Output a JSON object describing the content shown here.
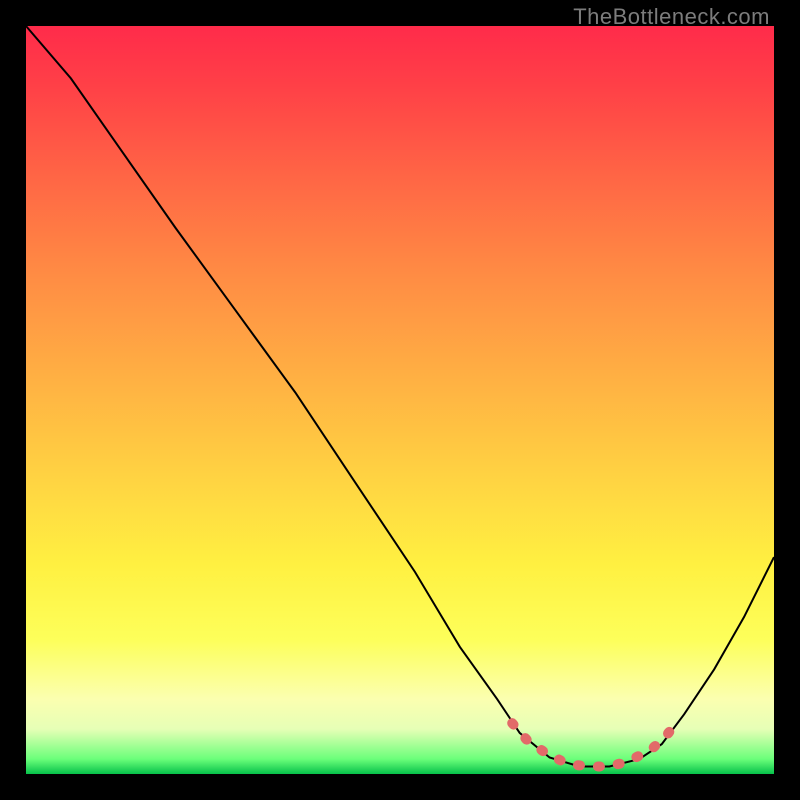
{
  "watermark": "TheBottleneck.com",
  "chart_data": {
    "type": "line",
    "title": "",
    "xlabel": "",
    "ylabel": "",
    "xlim": [
      0,
      1
    ],
    "ylim": [
      0,
      1
    ],
    "series": [
      {
        "name": "curve",
        "points": [
          {
            "x": 0.0,
            "y": 1.0
          },
          {
            "x": 0.06,
            "y": 0.93
          },
          {
            "x": 0.13,
            "y": 0.83
          },
          {
            "x": 0.2,
            "y": 0.73
          },
          {
            "x": 0.28,
            "y": 0.62
          },
          {
            "x": 0.36,
            "y": 0.51
          },
          {
            "x": 0.44,
            "y": 0.39
          },
          {
            "x": 0.52,
            "y": 0.27
          },
          {
            "x": 0.58,
            "y": 0.17
          },
          {
            "x": 0.63,
            "y": 0.1
          },
          {
            "x": 0.66,
            "y": 0.055
          },
          {
            "x": 0.7,
            "y": 0.022
          },
          {
            "x": 0.74,
            "y": 0.01
          },
          {
            "x": 0.78,
            "y": 0.01
          },
          {
            "x": 0.82,
            "y": 0.02
          },
          {
            "x": 0.85,
            "y": 0.04
          },
          {
            "x": 0.88,
            "y": 0.08
          },
          {
            "x": 0.92,
            "y": 0.14
          },
          {
            "x": 0.96,
            "y": 0.21
          },
          {
            "x": 1.0,
            "y": 0.29
          }
        ]
      }
    ],
    "highlight_band": {
      "name": "flat-region-dots",
      "points": [
        {
          "x": 0.65,
          "y": 0.068
        },
        {
          "x": 0.67,
          "y": 0.045
        },
        {
          "x": 0.695,
          "y": 0.028
        },
        {
          "x": 0.715,
          "y": 0.018
        },
        {
          "x": 0.735,
          "y": 0.012
        },
        {
          "x": 0.755,
          "y": 0.01
        },
        {
          "x": 0.775,
          "y": 0.01
        },
        {
          "x": 0.795,
          "y": 0.014
        },
        {
          "x": 0.815,
          "y": 0.022
        },
        {
          "x": 0.835,
          "y": 0.032
        },
        {
          "x": 0.855,
          "y": 0.05
        },
        {
          "x": 0.875,
          "y": 0.075
        }
      ]
    },
    "gradient_stops": [
      {
        "pos": 0.0,
        "color": "#ff2b4a"
      },
      {
        "pos": 0.5,
        "color": "#ffb043"
      },
      {
        "pos": 0.85,
        "color": "#fdff5a"
      },
      {
        "pos": 1.0,
        "color": "#06c24a"
      }
    ]
  }
}
